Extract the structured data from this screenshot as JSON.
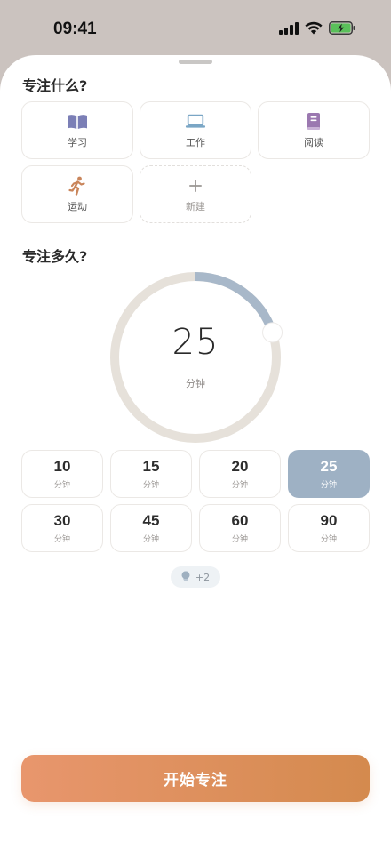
{
  "status_bar": {
    "time": "09:41"
  },
  "category_section": {
    "title": "专注什么?",
    "items": [
      {
        "label": "学习",
        "icon": "book-open-icon",
        "color": "#7b7fb6"
      },
      {
        "label": "工作",
        "icon": "laptop-icon",
        "color": "#7aa6c5"
      },
      {
        "label": "阅读",
        "icon": "book-icon",
        "color": "#9b78b0"
      },
      {
        "label": "运动",
        "icon": "running-icon",
        "color": "#c9855b"
      },
      {
        "label": "新建",
        "icon": "plus-icon",
        "color": "#9a9693"
      }
    ]
  },
  "duration_section": {
    "title": "专注多久?",
    "ring": {
      "value": "25",
      "unit": "分钟",
      "progress_fraction": 0.2,
      "progress_color": "#a8b8c9",
      "track_color": "#e6e1da"
    },
    "options": [
      {
        "value": "10",
        "unit": "分钟"
      },
      {
        "value": "15",
        "unit": "分钟"
      },
      {
        "value": "20",
        "unit": "分钟"
      },
      {
        "value": "25",
        "unit": "分钟",
        "selected": true
      },
      {
        "value": "30",
        "unit": "分钟"
      },
      {
        "value": "45",
        "unit": "分钟"
      },
      {
        "value": "60",
        "unit": "分钟"
      },
      {
        "value": "90",
        "unit": "分钟"
      }
    ]
  },
  "hint": {
    "icon": "lightbulb-icon",
    "text": "+2"
  },
  "start_button": {
    "label": "开始专注"
  },
  "colors": {
    "accent": "#d9885a",
    "selected": "#9eb1c4"
  }
}
